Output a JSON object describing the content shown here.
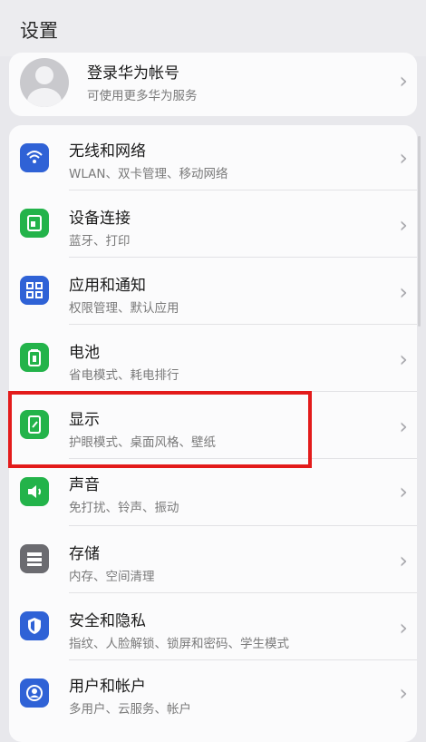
{
  "header": {
    "title": "设置"
  },
  "account": {
    "title": "登录华为帐号",
    "subtitle": "可使用更多华为服务"
  },
  "settings": [
    {
      "id": "wireless",
      "label": "无线和网络",
      "sub": "WLAN、双卡管理、移动网络",
      "icon": "wifi-icon",
      "color": "#2f62d6"
    },
    {
      "id": "device-connection",
      "label": "设备连接",
      "sub": "蓝牙、打印",
      "icon": "device-connect-icon",
      "color": "#23b34a"
    },
    {
      "id": "apps-notifications",
      "label": "应用和通知",
      "sub": "权限管理、默认应用",
      "icon": "apps-grid-icon",
      "color": "#2f62d6"
    },
    {
      "id": "battery",
      "label": "电池",
      "sub": "省电模式、耗电排行",
      "icon": "battery-icon",
      "color": "#23b34a"
    },
    {
      "id": "display",
      "label": "显示",
      "sub": "护眼模式、桌面风格、壁纸",
      "icon": "display-icon",
      "color": "#23b34a"
    },
    {
      "id": "sound",
      "label": "声音",
      "sub": "免打扰、铃声、振动",
      "icon": "speaker-icon",
      "color": "#23b34a"
    },
    {
      "id": "storage",
      "label": "存储",
      "sub": "内存、空间清理",
      "icon": "storage-icon",
      "color": "#6b6b70"
    },
    {
      "id": "security",
      "label": "安全和隐私",
      "sub": "指纹、人脸解锁、锁屏和密码、学生模式",
      "icon": "shield-icon",
      "color": "#2f62d6"
    },
    {
      "id": "users",
      "label": "用户和帐户",
      "sub": "多用户、云服务、帐户",
      "icon": "user-account-icon",
      "color": "#2f62d6"
    }
  ],
  "colors": {
    "highlight": "#e31b1b"
  }
}
